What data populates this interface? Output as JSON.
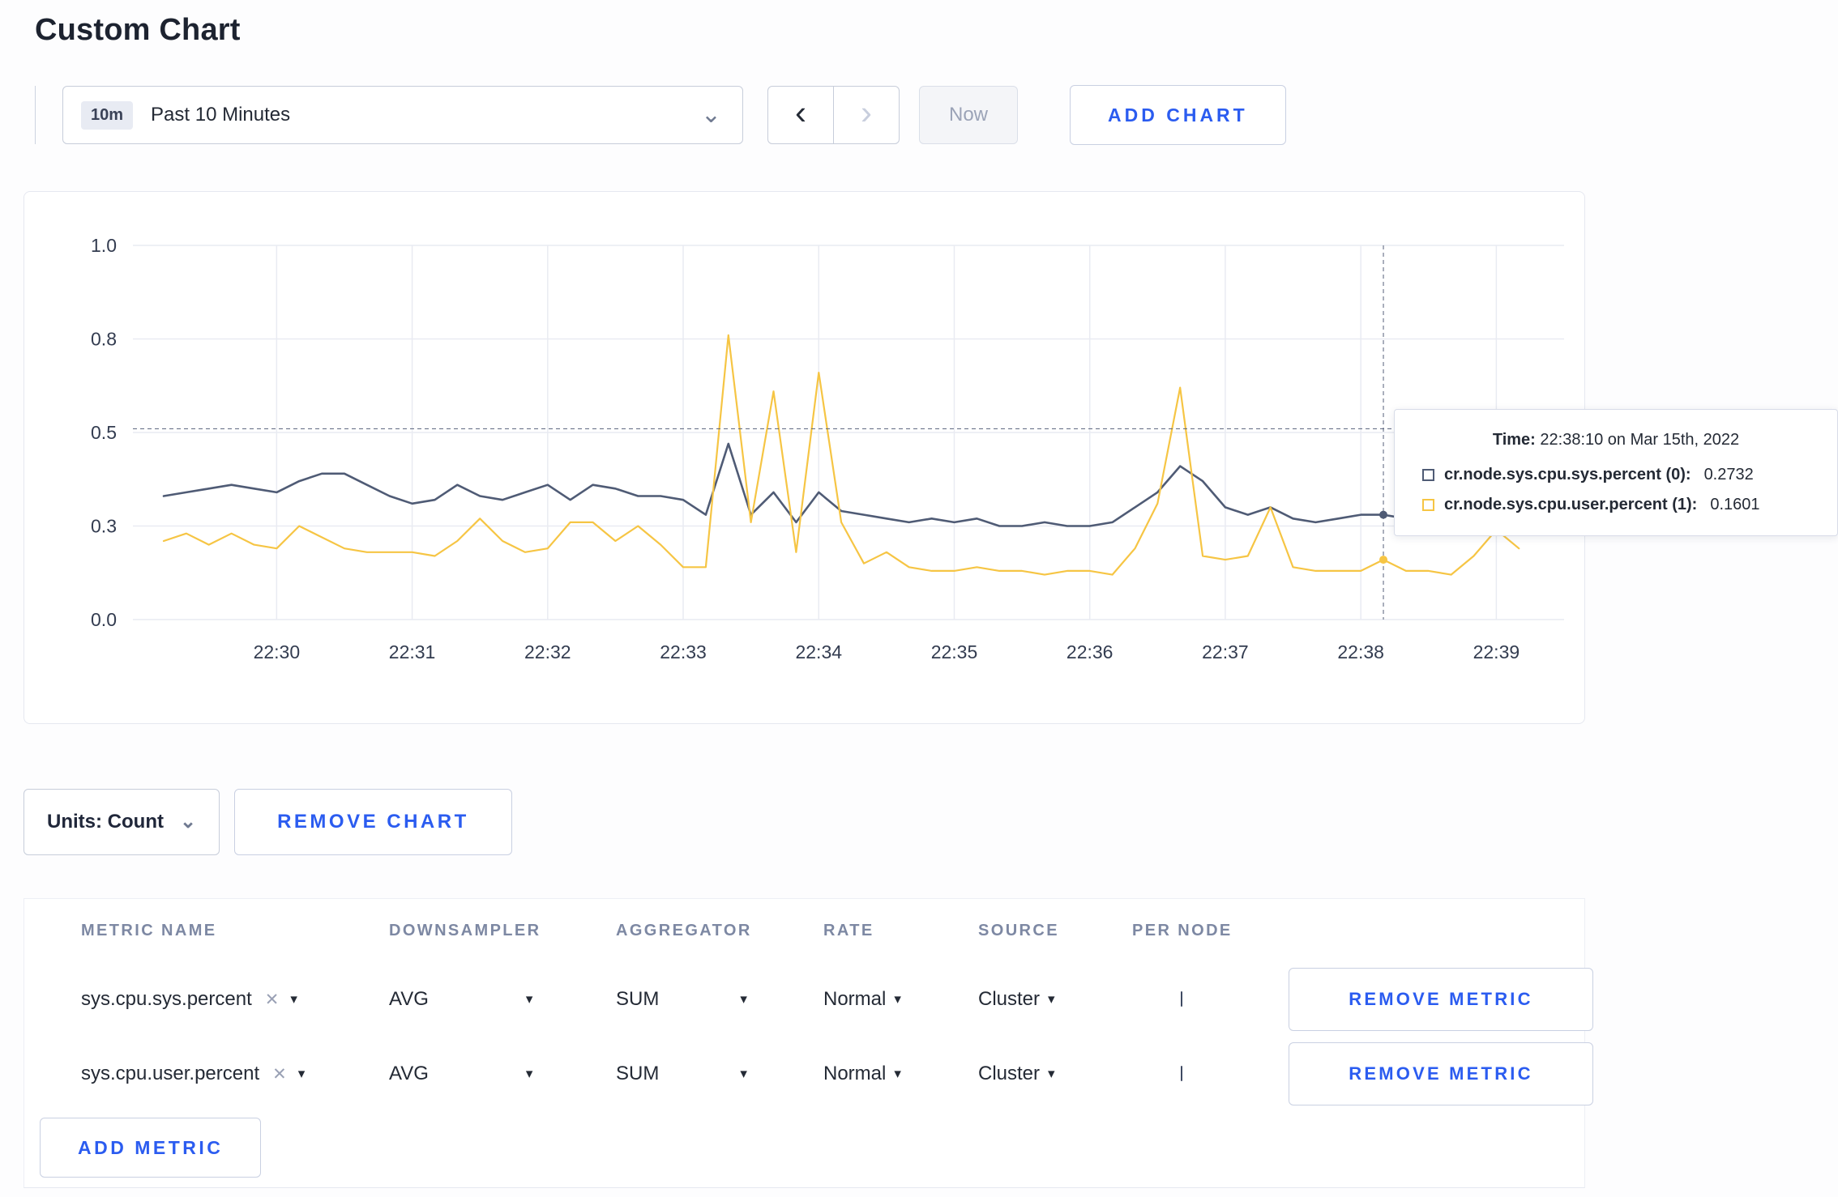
{
  "page": {
    "title": "Custom Chart"
  },
  "toolbar": {
    "time_badge": "10m",
    "time_label": "Past 10 Minutes",
    "chevron_down_icon": "⌄",
    "prev_icon": "‹",
    "next_icon": "›",
    "now_label": "Now",
    "add_chart_label": "ADD CHART"
  },
  "colors": {
    "accent_blue": "#2b5cf0",
    "series_sys": "#4f5b75",
    "series_user": "#f6c544",
    "gridline": "#e9ebf2",
    "crosshair": "#566079"
  },
  "chart_data": {
    "type": "line",
    "title": "",
    "xlabel": "",
    "ylabel": "",
    "grid": true,
    "legend_position": "tooltip",
    "ylim": [
      0,
      1
    ],
    "y_ticks": [
      {
        "label": "1.0",
        "value": 1.0
      },
      {
        "label": "0.8",
        "value": 0.75
      },
      {
        "label": "0.5",
        "value": 0.5
      },
      {
        "label": "0.3",
        "value": 0.25
      },
      {
        "label": "0.0",
        "value": 0.0
      }
    ],
    "x_ticks": [
      "22:30",
      "22:31",
      "22:32",
      "22:33",
      "22:34",
      "22:35",
      "22:36",
      "22:37",
      "22:38",
      "22:39"
    ],
    "x_domain": [
      "22:29:10",
      "22:39:30"
    ],
    "start_time": "22:29:10",
    "step_seconds": 10,
    "series": [
      {
        "name": "cr.node.sys.cpu.sys.percent",
        "color": "#4f5b75",
        "width": 2.6,
        "values": [
          0.33,
          0.34,
          0.35,
          0.36,
          0.35,
          0.34,
          0.37,
          0.39,
          0.39,
          0.36,
          0.33,
          0.31,
          0.32,
          0.36,
          0.33,
          0.32,
          0.34,
          0.36,
          0.32,
          0.36,
          0.35,
          0.33,
          0.33,
          0.32,
          0.28,
          0.47,
          0.28,
          0.34,
          0.26,
          0.34,
          0.29,
          0.28,
          0.27,
          0.26,
          0.27,
          0.26,
          0.27,
          0.25,
          0.25,
          0.26,
          0.25,
          0.25,
          0.26,
          0.3,
          0.34,
          0.41,
          0.37,
          0.3,
          0.28,
          0.3,
          0.27,
          0.26,
          0.27,
          0.28,
          0.28,
          0.27,
          0.26,
          0.28,
          0.29,
          0.27,
          0.28
        ]
      },
      {
        "name": "cr.node.sys.cpu.user.percent",
        "color": "#f6c544",
        "width": 2.2,
        "values": [
          0.21,
          0.23,
          0.2,
          0.23,
          0.2,
          0.19,
          0.25,
          0.22,
          0.19,
          0.18,
          0.18,
          0.18,
          0.17,
          0.21,
          0.27,
          0.21,
          0.18,
          0.19,
          0.26,
          0.26,
          0.21,
          0.25,
          0.2,
          0.14,
          0.14,
          0.76,
          0.26,
          0.61,
          0.18,
          0.66,
          0.26,
          0.15,
          0.18,
          0.14,
          0.13,
          0.13,
          0.14,
          0.13,
          0.13,
          0.12,
          0.13,
          0.13,
          0.12,
          0.19,
          0.31,
          0.62,
          0.17,
          0.16,
          0.17,
          0.3,
          0.14,
          0.13,
          0.13,
          0.13,
          0.16,
          0.13,
          0.13,
          0.12,
          0.17,
          0.24,
          0.19
        ]
      }
    ],
    "crosshair": {
      "time": "22:38:10",
      "y_value": 0.51
    }
  },
  "tooltip": {
    "time_label": "Time:",
    "time_value": "22:38:10 on Mar 15th, 2022",
    "rows": [
      {
        "label": "cr.node.sys.cpu.sys.percent (0):",
        "value": "0.2732",
        "color": "#4f5b75"
      },
      {
        "label": "cr.node.sys.cpu.user.percent (1):",
        "value": "0.1601",
        "color": "#f6c544"
      }
    ]
  },
  "chart_footer": {
    "units_label": "Units: Count",
    "units_chevron_icon": "⌄",
    "remove_chart_label": "REMOVE CHART"
  },
  "metrics_table": {
    "headers": [
      "METRIC NAME",
      "DOWNSAMPLER",
      "AGGREGATOR",
      "RATE",
      "SOURCE",
      "PER NODE"
    ],
    "remove_tag_icon": "✕",
    "caret_icon": "▾",
    "rows": [
      {
        "metric": "sys.cpu.sys.percent",
        "downsampler": "AVG",
        "aggregator": "SUM",
        "rate": "Normal",
        "source": "Cluster",
        "per_node_checked": false,
        "remove_label": "REMOVE METRIC"
      },
      {
        "metric": "sys.cpu.user.percent",
        "downsampler": "AVG",
        "aggregator": "SUM",
        "rate": "Normal",
        "source": "Cluster",
        "per_node_checked": false,
        "remove_label": "REMOVE METRIC"
      }
    ],
    "add_metric_label": "ADD METRIC"
  }
}
